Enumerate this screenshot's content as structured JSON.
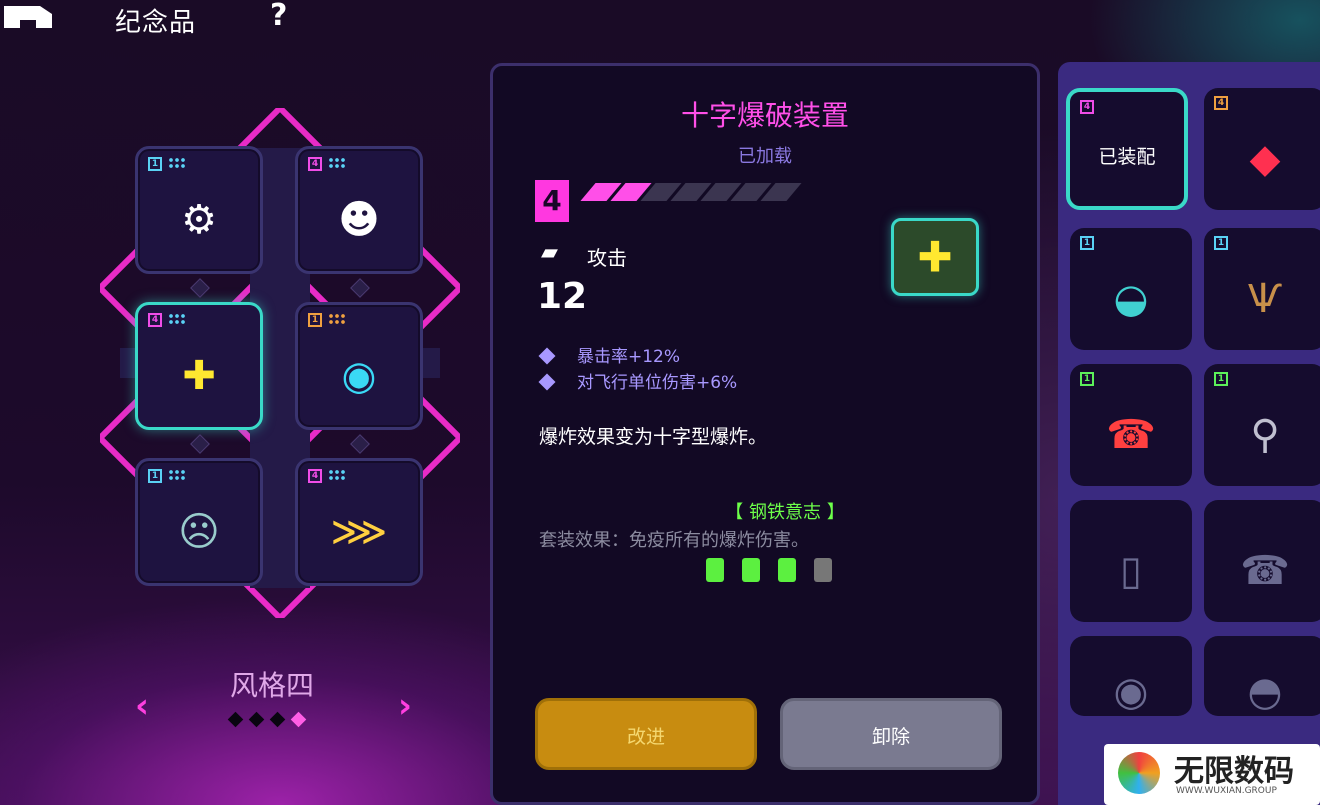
{
  "header": {
    "title": "纪念品",
    "help": "?"
  },
  "loadout": {
    "style_name": "风格四",
    "pages": 4,
    "current_page": 4,
    "slots": [
      {
        "level": "1",
        "icon": "bronze-gear-icon"
      },
      {
        "level": "4",
        "icon": "wooden-mask-icon"
      },
      {
        "level": "4",
        "icon": "cross-blast-device-icon",
        "selected": true
      },
      {
        "level": "1",
        "icon": "cyan-orb-icon"
      },
      {
        "level": "1",
        "icon": "stone-mask-icon"
      },
      {
        "level": "4",
        "icon": "ammo-belt-icon"
      }
    ]
  },
  "detail": {
    "name": "十字爆破装置",
    "status": "已加载",
    "level": "4",
    "level_progress": {
      "filled": 2,
      "total": 7
    },
    "attack_label": "攻击",
    "attack_value": "12",
    "stats": [
      "暴击率+12%",
      "对飞行单位伤害+6%"
    ],
    "description": "爆炸效果变为十字型爆炸。",
    "set_name": "【 钢铁意志 】",
    "set_effect": "套装效果：免疫所有的爆炸伤害。",
    "set_progress": {
      "owned": 3,
      "total": 4
    },
    "upgrade_button": "改进",
    "remove_button": "卸除"
  },
  "inventory": {
    "equipped_label": "已装配",
    "items": [
      {
        "level": "4",
        "icon": "cross-blast-device-icon",
        "equipped": true
      },
      {
        "level": "4",
        "icon": "red-gem-icon"
      },
      {
        "level": "1",
        "icon": "platypus-icon"
      },
      {
        "level": "1",
        "icon": "antler-icon"
      },
      {
        "level": "1",
        "icon": "red-telephone-icon"
      },
      {
        "level": "1",
        "icon": "magnifier-icon"
      },
      {
        "level": "",
        "icon": "empty-jar-icon"
      },
      {
        "level": "",
        "icon": "rotary-phone-icon"
      },
      {
        "level": "",
        "icon": "eye-icon"
      },
      {
        "level": "",
        "icon": "bowler-hat-icon"
      }
    ]
  },
  "watermark": {
    "text": "无限数码",
    "sub": "WWW.WUXIAN.GROUP"
  },
  "colors": {
    "accent_pink": "#ff4fe8",
    "accent_teal": "#3ad9c8",
    "set_green": "#6dff4a",
    "stat_purple": "#a898ff"
  }
}
